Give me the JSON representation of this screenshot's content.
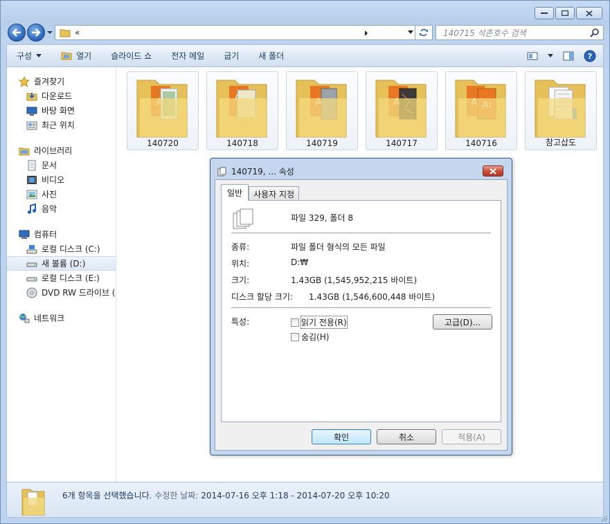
{
  "window": {
    "address": {
      "crumb": "«"
    },
    "search_placeholder": "140715 석촌호수 검색"
  },
  "toolbar": {
    "organize": "구성",
    "open": "열기",
    "slideshow": "슬라이드 쇼",
    "email": "전자 메일",
    "burn": "굽기",
    "new_folder": "새 폴더"
  },
  "nav": {
    "favorites": {
      "label": "즐겨찾기",
      "items": [
        {
          "label": "다운로드",
          "icon": "download-folder-icon"
        },
        {
          "label": "바탕 화면",
          "icon": "desktop-icon"
        },
        {
          "label": "최근 위치",
          "icon": "recent-places-icon"
        }
      ]
    },
    "libraries": {
      "label": "라이브러리",
      "items": [
        {
          "label": "문서",
          "icon": "documents-icon"
        },
        {
          "label": "비디오",
          "icon": "videos-icon"
        },
        {
          "label": "사진",
          "icon": "pictures-icon"
        },
        {
          "label": "음악",
          "icon": "music-icon"
        }
      ]
    },
    "computer": {
      "label": "컴퓨터",
      "items": [
        {
          "label": "로컬 디스크 (C:)",
          "icon": "drive-c-icon"
        },
        {
          "label": "새 볼륨 (D:)",
          "icon": "drive-d-icon",
          "selected": true
        },
        {
          "label": "로컬 디스크 (E:)",
          "icon": "drive-e-icon"
        },
        {
          "label": "DVD RW 드라이브 (",
          "icon": "dvd-drive-icon"
        }
      ]
    },
    "network": {
      "label": "네트워크"
    }
  },
  "files": [
    {
      "name": "140720"
    },
    {
      "name": "140718"
    },
    {
      "name": "140719"
    },
    {
      "name": "140717"
    },
    {
      "name": "140716"
    },
    {
      "name": "참고삽도"
    }
  ],
  "status": {
    "selected": "6개 항목을 선택했습니다.",
    "modified_label": "수정한 날짜:",
    "modified_value": "2014-07-16 오후 1:18 - 2014-07-20 오후 10:20"
  },
  "dialog": {
    "title": "140719, ... 속성",
    "tabs": [
      "일반",
      "사용자 지정"
    ],
    "summary": "파일 329, 폴더 8",
    "type_label": "종류:",
    "type_value": "파일 폴더 형식의 모든 파일",
    "location_label": "위치:",
    "location_value": "D:₩",
    "size_label": "크기:",
    "size_value": "1.43GB (1,545,952,215 바이트)",
    "disk_size_label": "디스크 할당 크기:",
    "disk_size_value": "1.43GB (1,546,600,448 바이트)",
    "attributes_label": "특성:",
    "readonly_label": "읽기 전용(R)",
    "hidden_label": "숨김(H)",
    "advanced_label": "고급(D)...",
    "ok": "확인",
    "cancel": "취소",
    "apply": "적용(A)"
  }
}
